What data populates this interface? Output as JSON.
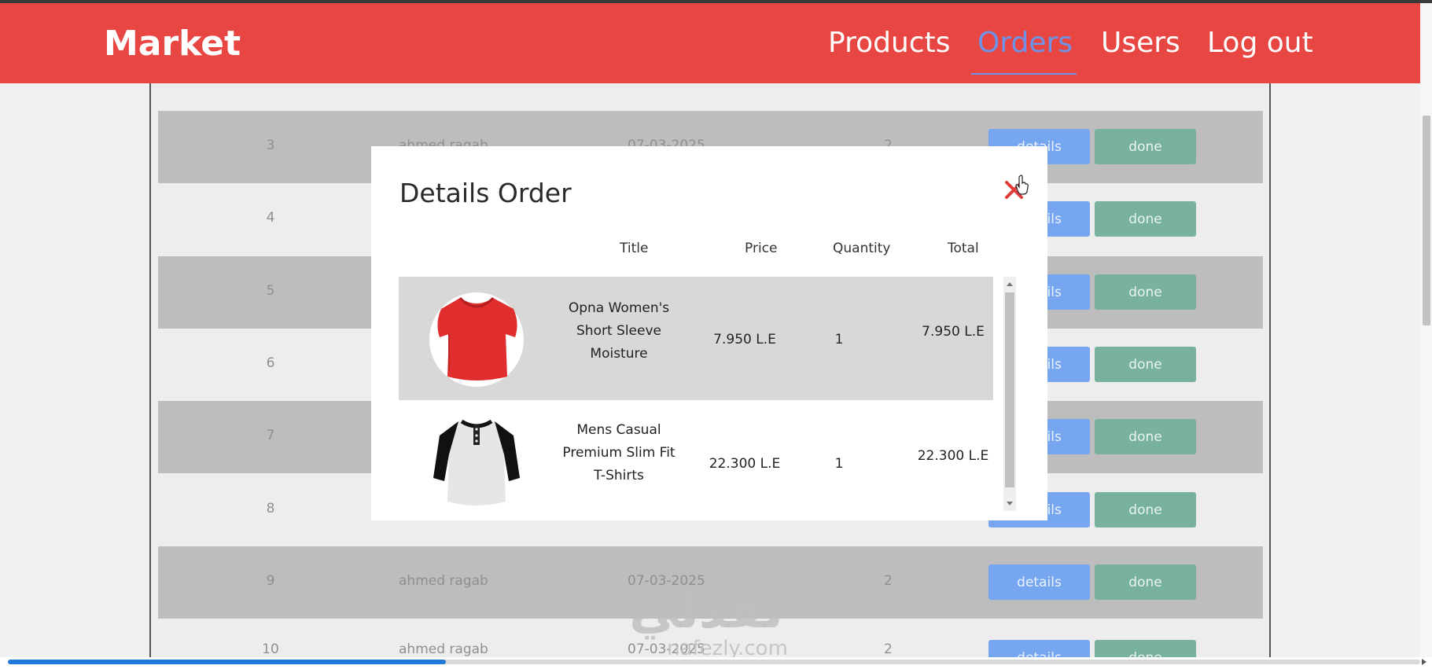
{
  "navbar": {
    "brand": "Market",
    "items": [
      {
        "label": "Products"
      },
      {
        "label": "Orders"
      },
      {
        "label": "Users"
      },
      {
        "label": "Log out"
      }
    ],
    "active_item": "Orders",
    "colors": {
      "bar": "#e74643",
      "active": "#6d94e8"
    }
  },
  "orders": {
    "rows": [
      {
        "id": "3",
        "name": "ahmed ragab",
        "date": "07-03-2025",
        "qty": "2",
        "details_label": "details",
        "done_label": "done"
      },
      {
        "id": "4",
        "name": "",
        "date": "",
        "qty": "",
        "details_label": "details",
        "done_label": "done"
      },
      {
        "id": "5",
        "name": "",
        "date": "",
        "qty": "",
        "details_label": "details",
        "done_label": "done"
      },
      {
        "id": "6",
        "name": "",
        "date": "",
        "qty": "",
        "details_label": "details",
        "done_label": "done"
      },
      {
        "id": "7",
        "name": "",
        "date": "",
        "qty": "",
        "details_label": "details",
        "done_label": "done"
      },
      {
        "id": "8",
        "name": "",
        "date": "",
        "qty": "",
        "details_label": "details",
        "done_label": "done"
      },
      {
        "id": "9",
        "name": "ahmed ragab",
        "date": "07-03-2025",
        "qty": "2",
        "details_label": "details",
        "done_label": "done"
      },
      {
        "id": "10",
        "name": "ahmed ragab",
        "date": "07-03-2025",
        "qty": "2",
        "details_label": "details",
        "done_label": "done"
      }
    ],
    "colors": {
      "details": "#76a6ef",
      "done": "#79b29c"
    }
  },
  "modal": {
    "title": "Details Order",
    "close_icon": "close-x-icon",
    "columns": {
      "title": "Title",
      "price": "Price",
      "quantity": "Quantity",
      "total": "Total"
    },
    "items": [
      {
        "title_lines": [
          "Opna Women's",
          "Short Sleeve",
          "Moisture"
        ],
        "price": "7.950 L.E",
        "quantity": "1",
        "total": "7.950 L.E",
        "image": "red-womens-tshirt-image"
      },
      {
        "title_lines": [
          "Mens Casual",
          "Premium Slim Fit",
          "T-Shirts"
        ],
        "price": "22.300 L.E",
        "quantity": "1",
        "total": "22.300 L.E",
        "image": "raglan-mens-tshirt-image"
      }
    ],
    "close_color": "#e03a3a"
  },
  "watermark": {
    "text": "نفذلي",
    "url": "nafezly.com"
  },
  "video_progress": {
    "fraction": 0.31
  }
}
